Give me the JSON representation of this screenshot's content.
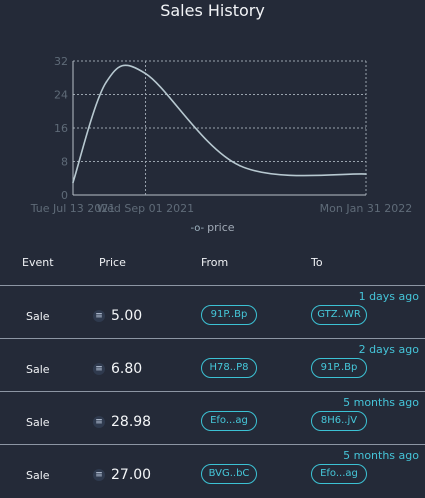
{
  "page": {
    "title": "Sales History"
  },
  "chart_data": {
    "type": "line",
    "title": "Sales History",
    "xlabel": "",
    "ylabel": "",
    "x_tick_labels": [
      "Tue Jul 13 2021",
      "Wed Sep 01 2021",
      "Mon Jan 31 2022"
    ],
    "y_ticks": [
      0,
      8,
      16,
      24,
      32
    ],
    "ylim": [
      0,
      32
    ],
    "xlim": [
      "2021-07-13",
      "2022-01-31"
    ],
    "grid": "dashed",
    "legend": "bottom-center",
    "series": [
      {
        "name": "price",
        "x": [
          "2021-07-13",
          "2021-08-05",
          "2021-09-01",
          "2021-11-05",
          "2022-01-31"
        ],
        "y": [
          3.0,
          27.0,
          29.0,
          7.0,
          5.0
        ]
      }
    ]
  },
  "table": {
    "headers": {
      "event": "Event",
      "price": "Price",
      "from": "From",
      "to": "To"
    },
    "rows": [
      {
        "time": "1 days ago",
        "event": "Sale",
        "price": "5.00",
        "from": "91P..Bp",
        "to": "GTZ..WR"
      },
      {
        "time": "2 days ago",
        "event": "Sale",
        "price": "6.80",
        "from": "H78..P8",
        "to": "91P..Bp"
      },
      {
        "time": "5 months ago",
        "event": "Sale",
        "price": "28.98",
        "from": "Efo...ag",
        "to": "8H6..jV"
      },
      {
        "time": "5 months ago",
        "event": "Sale",
        "price": "27.00",
        "from": "BVG..bC",
        "to": "Efo...ag"
      }
    ]
  },
  "icons": {
    "currency": "currency-icon"
  }
}
